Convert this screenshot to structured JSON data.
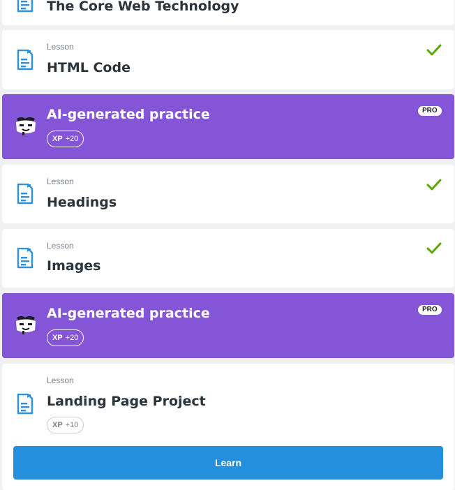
{
  "items": [
    {
      "kind": "lesson",
      "type_label": "",
      "title": "The Core Web Technology",
      "completed": false
    },
    {
      "kind": "lesson",
      "type_label": "Lesson",
      "title": "HTML Code",
      "completed": true
    },
    {
      "kind": "practice",
      "title": "AI-generated practice",
      "badge": "PRO",
      "xp_key": "XP",
      "xp_value": "+20"
    },
    {
      "kind": "lesson",
      "type_label": "Lesson",
      "title": "Headings",
      "completed": true
    },
    {
      "kind": "lesson",
      "type_label": "Lesson",
      "title": "Images",
      "completed": true
    },
    {
      "kind": "practice",
      "title": "AI-generated practice",
      "badge": "PRO",
      "xp_key": "XP",
      "xp_value": "+20"
    },
    {
      "kind": "lesson",
      "type_label": "Lesson",
      "title": "Landing Page Project",
      "completed": false,
      "xp_key": "XP",
      "xp_value": "+10",
      "action_label": "Learn"
    }
  ],
  "colors": {
    "practice_bg": "#8555d8",
    "accent_blue": "#2490dd",
    "check_green": "#5aa800"
  },
  "icons": {
    "lesson": "document-icon",
    "practice": "ai-bot-icon",
    "completed": "checkmark-icon"
  }
}
